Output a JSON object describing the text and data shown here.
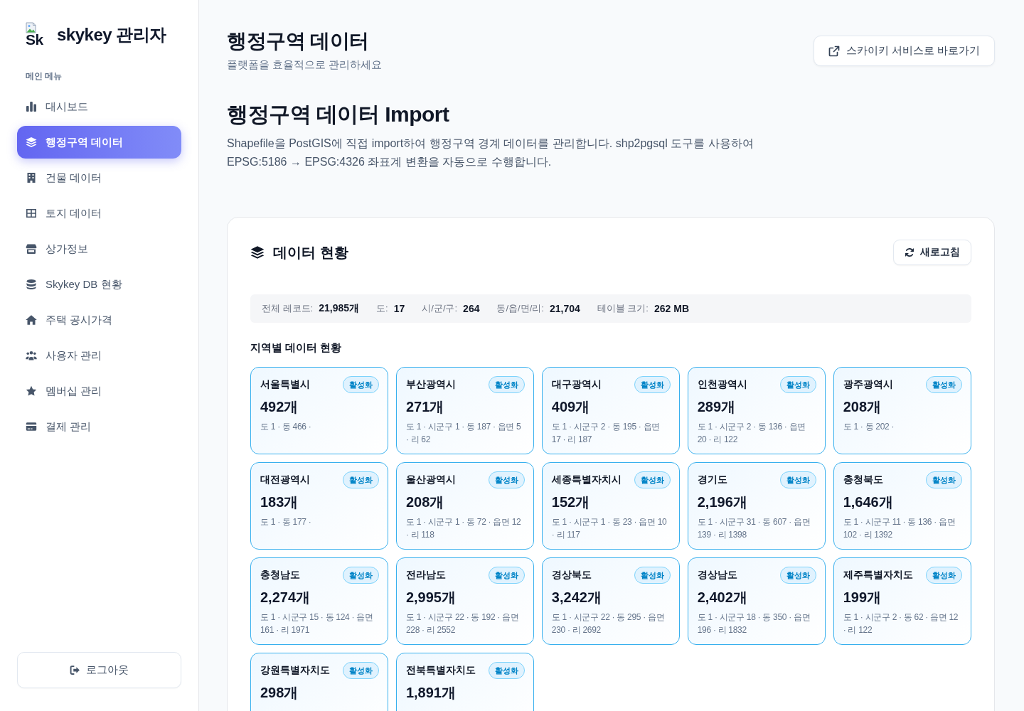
{
  "sidebar": {
    "logo": {
      "alt_text": "Sk",
      "title": "skykey 관리자"
    },
    "section_label": "메인 메뉴",
    "items": [
      {
        "label": "대시보드",
        "selected": false
      },
      {
        "label": "행정구역 데이터",
        "selected": true
      },
      {
        "label": "건물 데이터",
        "selected": false
      },
      {
        "label": "토지 데이터",
        "selected": false
      },
      {
        "label": "상가정보",
        "selected": false
      },
      {
        "label": "Skykey DB 현황",
        "selected": false
      },
      {
        "label": "주택 공시가격",
        "selected": false
      },
      {
        "label": "사용자 관리",
        "selected": false
      },
      {
        "label": "멤버십 관리",
        "selected": false
      },
      {
        "label": "결제 관리",
        "selected": false
      }
    ],
    "logout": "로그아웃"
  },
  "header": {
    "title": "행정구역 데이터",
    "subtitle": "플랫폼을 효율적으로 관리하세요",
    "link_button": "스카이키 서비스로 바로가기"
  },
  "import_section": {
    "title": "행정구역 데이터 Import",
    "description": "Shapefile을 PostGIS에 직접 import하여 행정구역 경계 데이터를 관리합니다. shp2pgsql 도구를 사용하여 EPSG:5186 → EPSG:4326 좌표계 변환을 자동으로 수행합니다."
  },
  "status_panel": {
    "title": "데이터 현황",
    "refresh_button": "새로고침",
    "stats": [
      {
        "label": "전체 레코드:",
        "value": "21,985개"
      },
      {
        "label": "도:",
        "value": "17"
      },
      {
        "label": "시/군/구:",
        "value": "264"
      },
      {
        "label": "동/읍/면/리:",
        "value": "21,704"
      },
      {
        "label": "테이블 크기:",
        "value": "262 MB"
      }
    ],
    "regions_title": "지역별 데이터 현황",
    "regions": [
      {
        "name": "서울특별시",
        "status": "활성화",
        "active": true,
        "count": "492개",
        "detail": "도 1 · 동 466 ·"
      },
      {
        "name": "부산광역시",
        "status": "활성화",
        "active": true,
        "count": "271개",
        "detail": "도 1 · 시군구 1 · 동 187 · 읍면 5 · 리 62"
      },
      {
        "name": "대구광역시",
        "status": "활성화",
        "active": true,
        "count": "409개",
        "detail": "도 1 · 시군구 2 · 동 195 · 읍면 17 · 리 187"
      },
      {
        "name": "인천광역시",
        "status": "활성화",
        "active": true,
        "count": "289개",
        "detail": "도 1 · 시군구 2 · 동 136 · 읍면 20 · 리 122"
      },
      {
        "name": "광주광역시",
        "status": "활성화",
        "active": true,
        "count": "208개",
        "detail": "도 1 · 동 202 ·"
      },
      {
        "name": "대전광역시",
        "status": "활성화",
        "active": true,
        "count": "183개",
        "detail": "도 1 · 동 177 ·"
      },
      {
        "name": "울산광역시",
        "status": "활성화",
        "active": true,
        "count": "208개",
        "detail": "도 1 · 시군구 1 · 동 72 · 읍면 12 · 리 118"
      },
      {
        "name": "세종특별자치시",
        "status": "활성화",
        "active": true,
        "count": "152개",
        "detail": "도 1 · 시군구 1 · 동 23 · 읍면 10 · 리 117"
      },
      {
        "name": "경기도",
        "status": "활성화",
        "active": true,
        "count": "2,196개",
        "detail": "도 1 · 시군구 31 · 동 607 · 읍면 139 · 리 1398"
      },
      {
        "name": "충청북도",
        "status": "활성화",
        "active": true,
        "count": "1,646개",
        "detail": "도 1 · 시군구 11 · 동 136 · 읍면 102 · 리 1392"
      },
      {
        "name": "충청남도",
        "status": "활성화",
        "active": true,
        "count": "2,274개",
        "detail": "도 1 · 시군구 15 · 동 124 · 읍면 161 · 리 1971"
      },
      {
        "name": "전라남도",
        "status": "활성화",
        "active": true,
        "count": "2,995개",
        "detail": "도 1 · 시군구 22 · 동 192 · 읍면 228 · 리 2552"
      },
      {
        "name": "경상북도",
        "status": "활성화",
        "active": true,
        "count": "3,242개",
        "detail": "도 1 · 시군구 22 · 동 295 · 읍면 230 · 리 2692"
      },
      {
        "name": "경상남도",
        "status": "활성화",
        "active": true,
        "count": "2,402개",
        "detail": "도 1 · 시군구 18 · 동 350 · 읍면 196 · 리 1832"
      },
      {
        "name": "제주특별자치도",
        "status": "활성화",
        "active": true,
        "count": "199개",
        "detail": "도 1 · 시군구 2 · 동 62 · 읍면 12 · 리 122"
      },
      {
        "name": "강원특별자치도",
        "status": "활성화",
        "active": true,
        "count": "298개"
      },
      {
        "name": "전북특별자치도",
        "status": "활성화",
        "active": true,
        "count": "1,891개"
      }
    ]
  }
}
